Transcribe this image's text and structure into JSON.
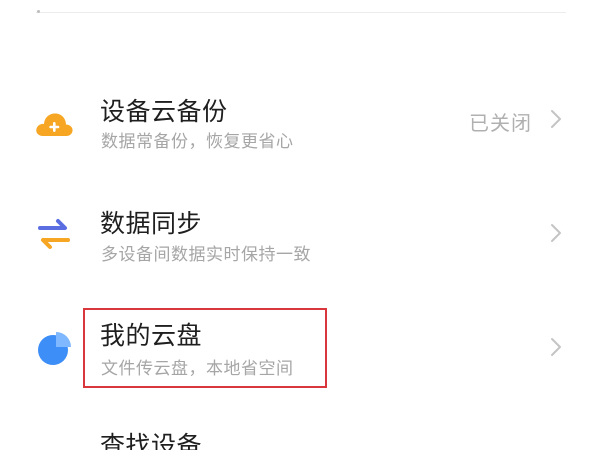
{
  "settings_list": {
    "items": [
      {
        "title": "设备云备份",
        "subtitle": "数据常备份，恢复更省心",
        "status": "已关闭",
        "icon": "cloud-plus-icon",
        "icon_color": "#f6a623"
      },
      {
        "title": "数据同步",
        "subtitle": "多设备间数据实时保持一致",
        "status": "",
        "icon": "sync-arrows-icon",
        "icon_color": "#5b6ee1"
      },
      {
        "title": "我的云盘",
        "subtitle": "文件传云盘，本地省空间",
        "status": "",
        "icon": "cloud-drive-pie-icon",
        "icon_color": "#3d8ef6"
      }
    ],
    "partial_item_title": "查找设备"
  },
  "colors": {
    "highlight_border": "#d9363e",
    "title_text": "#1f1f1f",
    "subtitle_text": "#a6a6a6",
    "chevron": "#c4c4c4"
  }
}
